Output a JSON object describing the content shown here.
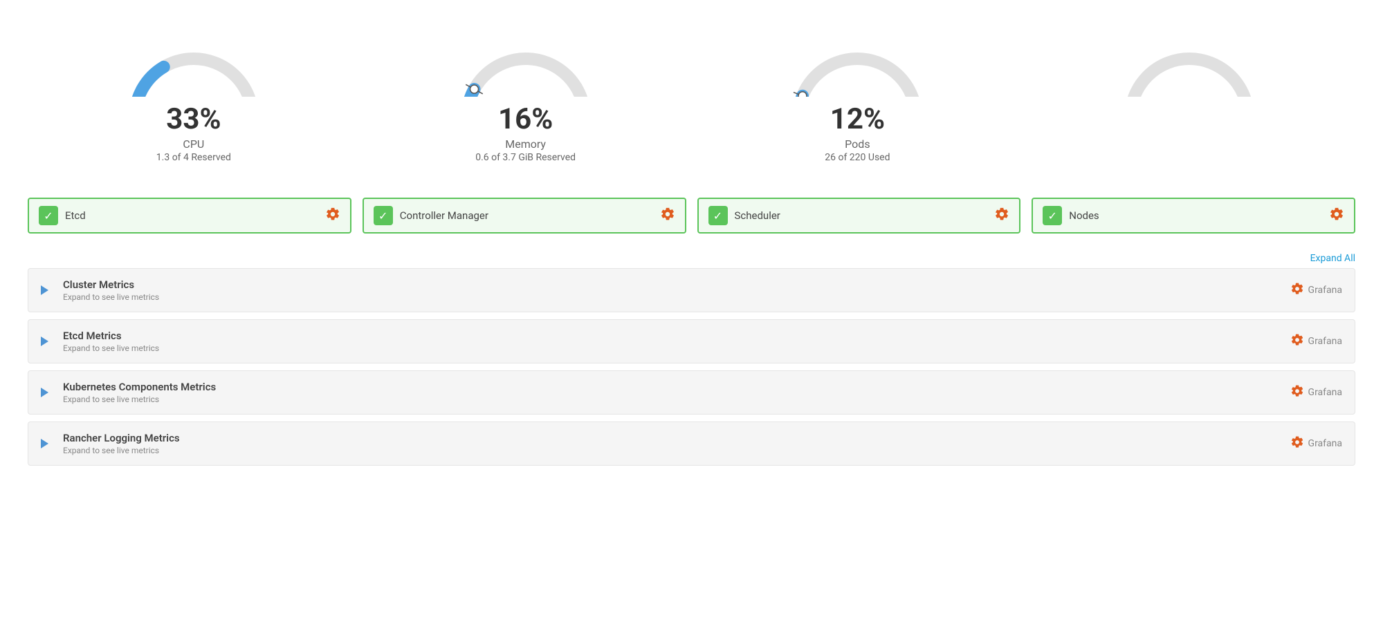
{
  "gauges": [
    {
      "id": "cpu",
      "percent": "33%",
      "label": "CPU",
      "sublabel": "1.3 of 4 Reserved",
      "value": 33,
      "color": "#4fa3e3",
      "has_handle": false
    },
    {
      "id": "memory",
      "percent": "16%",
      "label": "Memory",
      "sublabel": "0.6 of 3.7 GiB Reserved",
      "value": 16,
      "color": "#4fa3e3",
      "has_handle": true
    },
    {
      "id": "pods",
      "percent": "12%",
      "label": "Pods",
      "sublabel": "26 of 220 Used",
      "value": 12,
      "color": "#4fa3e3",
      "has_handle": true
    },
    {
      "id": "fourth",
      "percent": "",
      "label": "",
      "sublabel": "",
      "value": 0,
      "color": "#e0e0e0",
      "has_handle": false
    }
  ],
  "status_cards": [
    {
      "id": "etcd",
      "label": "Etcd",
      "status": "ok"
    },
    {
      "id": "controller-manager",
      "label": "Controller Manager",
      "status": "ok"
    },
    {
      "id": "scheduler",
      "label": "Scheduler",
      "status": "ok"
    },
    {
      "id": "nodes",
      "label": "Nodes",
      "status": "ok"
    }
  ],
  "expand_all_label": "Expand All",
  "metrics": [
    {
      "id": "cluster-metrics",
      "title": "Cluster Metrics",
      "subtitle": "Expand to see live metrics",
      "grafana_label": "Grafana"
    },
    {
      "id": "etcd-metrics",
      "title": "Etcd Metrics",
      "subtitle": "Expand to see live metrics",
      "grafana_label": "Grafana"
    },
    {
      "id": "kubernetes-components-metrics",
      "title": "Kubernetes Components Metrics",
      "subtitle": "Expand to see live metrics",
      "grafana_label": "Grafana"
    },
    {
      "id": "rancher-logging-metrics",
      "title": "Rancher Logging Metrics",
      "subtitle": "Expand to see live metrics",
      "grafana_label": "Grafana"
    }
  ]
}
